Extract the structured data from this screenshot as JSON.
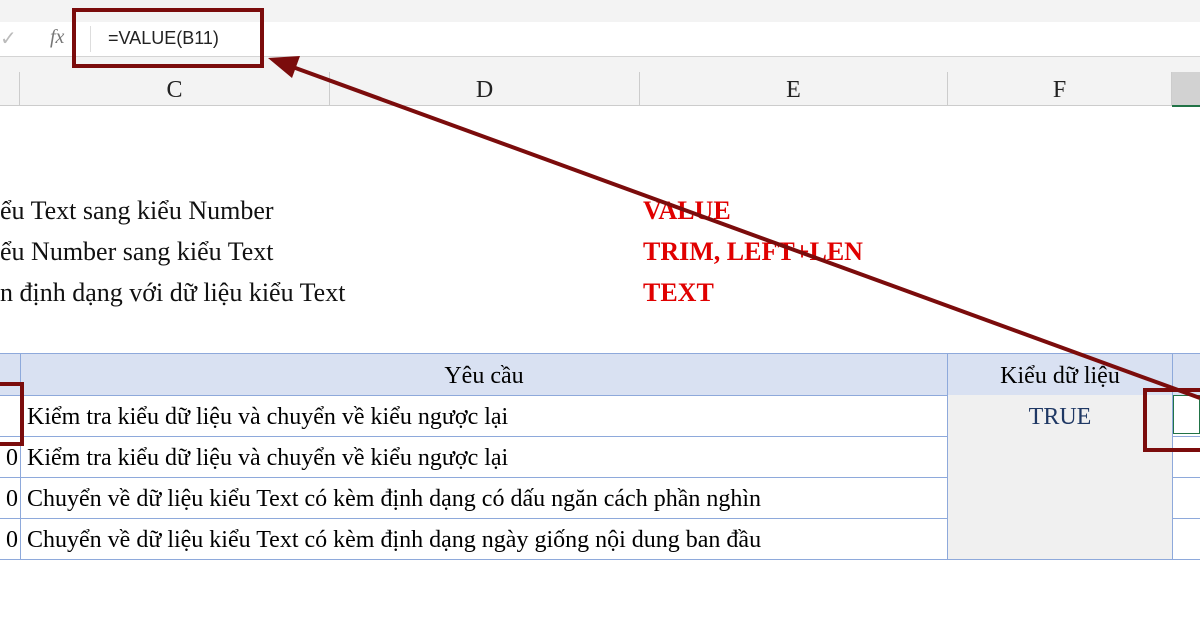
{
  "formula_bar": {
    "formula": "=VALUE(B11)",
    "fx": "fx",
    "check": "✓"
  },
  "columns": [
    "C",
    "D",
    "E",
    "F"
  ],
  "notes": [
    {
      "text": "ểu Text sang kiểu Number",
      "func": "VALUE"
    },
    {
      "text": "ểu Number sang kiểu Text",
      "func": "TRIM, LEFT+LEN"
    },
    {
      "text": "n định dạng với dữ liệu kiểu Text",
      "func": "TEXT"
    }
  ],
  "table": {
    "headers": {
      "request": "Yêu cầu",
      "type": "Kiểu dữ liệu"
    },
    "rows": [
      {
        "b": "",
        "request": "Kiểm tra kiểu dữ liệu và chuyển về kiểu ngược lại",
        "type": "TRUE"
      },
      {
        "b": "0",
        "request": "Kiểm tra kiểu dữ liệu và chuyển về kiểu ngược lại",
        "type": ""
      },
      {
        "b": "0",
        "request": "Chuyển về dữ liệu kiểu Text có kèm định dạng có dấu ngăn cách phần nghìn",
        "type": ""
      },
      {
        "b": "0",
        "request": "Chuyển về dữ liệu kiểu Text có kèm định dạng ngày giống nội dung ban đầu",
        "type": ""
      }
    ]
  },
  "colors": {
    "annotation": "#7b0c0c",
    "header_fill": "#d9e1f2",
    "function_text": "#e00000",
    "true_text": "#1f3864"
  }
}
